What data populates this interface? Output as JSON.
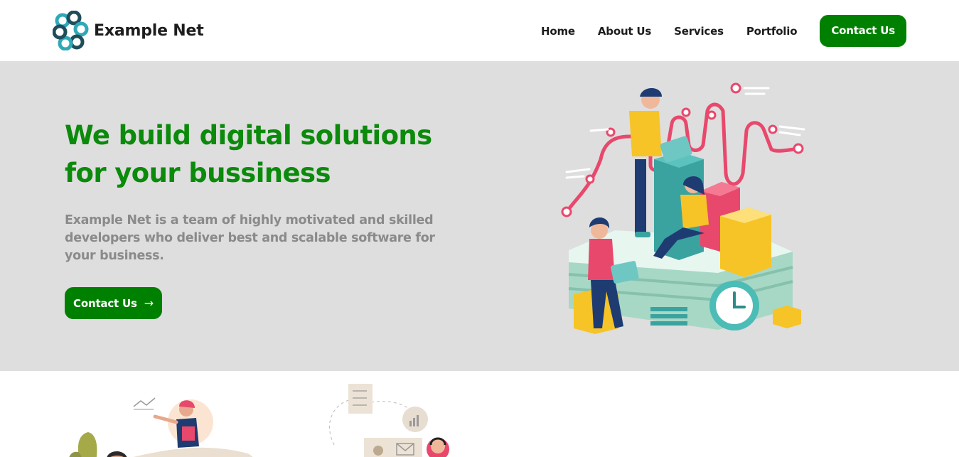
{
  "brand": {
    "name": "Example Net",
    "logo_icon": "interlocked-rings-logo",
    "accent_color": "#008000"
  },
  "nav": {
    "items": [
      {
        "label": "Home"
      },
      {
        "label": "About Us"
      },
      {
        "label": "Services"
      },
      {
        "label": "Portfolio"
      }
    ],
    "cta_label": "Contact Us"
  },
  "hero": {
    "title_line1": "We build digital solutions",
    "title_line2": "for your bussiness",
    "description": "Example Net is a team of highly motivated and skilled developers who deliver best and scalable software for your business.",
    "button_label": "Contact Us",
    "button_icon": "arrow-right-icon",
    "background": "#dedede",
    "title_color": "#0b8a0b"
  },
  "illustrations": {
    "hero": "team-building-blocks-illustration",
    "lower_left": "support-agent-illustration",
    "lower_right": "workflow-checklist-illustration"
  }
}
